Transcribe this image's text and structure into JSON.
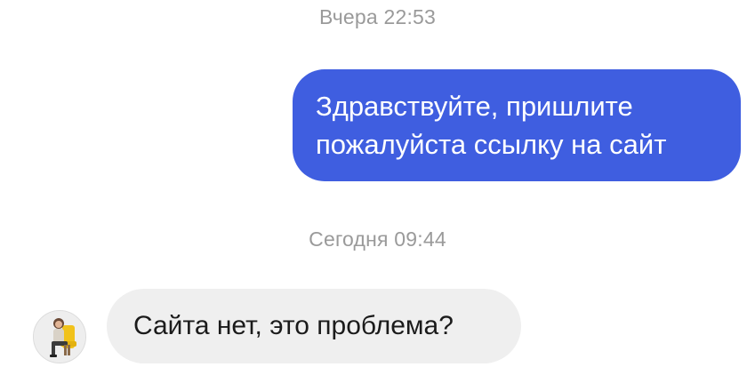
{
  "chat": {
    "timestamps": [
      "Вчера 22:53",
      "Сегодня 09:44"
    ],
    "outgoing_message": {
      "lines": [
        "Здравствуйте, пришлите",
        "пожалуйста ссылку на сайт"
      ],
      "bubble_color": "#3f5ee0"
    },
    "incoming_message": {
      "text": "Сайта нет, это проблема?",
      "bubble_color": "#efefef"
    },
    "avatar": {
      "icon": "user-photo-avatar"
    }
  }
}
